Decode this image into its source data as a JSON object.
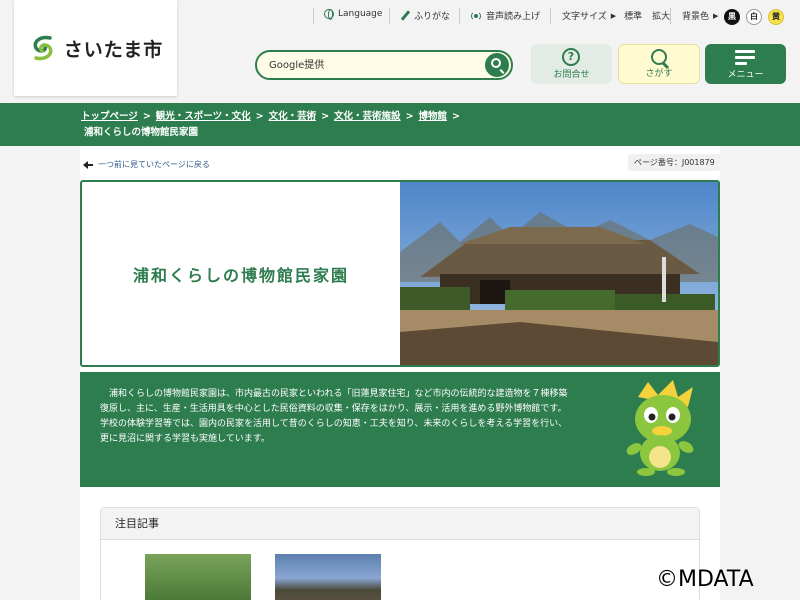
{
  "utility": {
    "language": "Language",
    "furigana": "ふりがな",
    "speech": "音声読み上げ",
    "font_size_label": "文字サイズ",
    "font_standard": "標準",
    "font_large": "拡大",
    "bg_label": "背景色",
    "bg_black": "黒",
    "bg_white": "白",
    "bg_yellow": "黄",
    "arrow": "▶"
  },
  "logo": {
    "text": "さいたま市"
  },
  "search": {
    "placeholder": "Google提供"
  },
  "header_buttons": {
    "inquiry": "お問合せ",
    "find": "さがす",
    "menu": "メニュー",
    "inquiry_glyph": "?"
  },
  "breadcrumb": {
    "items": [
      "トップページ",
      "観光・スポーツ・文化",
      "文化・芸術",
      "文化・芸術施設",
      "博物館"
    ],
    "separator": ">",
    "current": "浦和くらしの博物館民家園"
  },
  "back_link": "一つ前に見ていたページに戻る",
  "page_number": "ページ番号：J001879",
  "hero": {
    "title": "浦和くらしの博物館民家園"
  },
  "intro": {
    "lines": [
      "　浦和くらしの博物館民家園は、市内最古の民家といわれる「旧蓮見家住宅」など市内の伝統的な建造物を７棟移築",
      "復原し、主に、生産・生活用具を中心とした民俗資料の収集・保存をはかり、展示・活用を進める野外博物館です。",
      "学校の体験学習等では、園内の民家を活用して昔のくらしの知恵・工夫を知り、未来のくらしを考える学習を行い、",
      "更に見沼に関する学習も実施しています。"
    ]
  },
  "featured": {
    "heading": "注目記事"
  },
  "copyright": "©MDATA",
  "colors": {
    "brand_green": "#2e7d4f",
    "search_bg": "#fffde8",
    "find_bg": "#fffad0"
  }
}
